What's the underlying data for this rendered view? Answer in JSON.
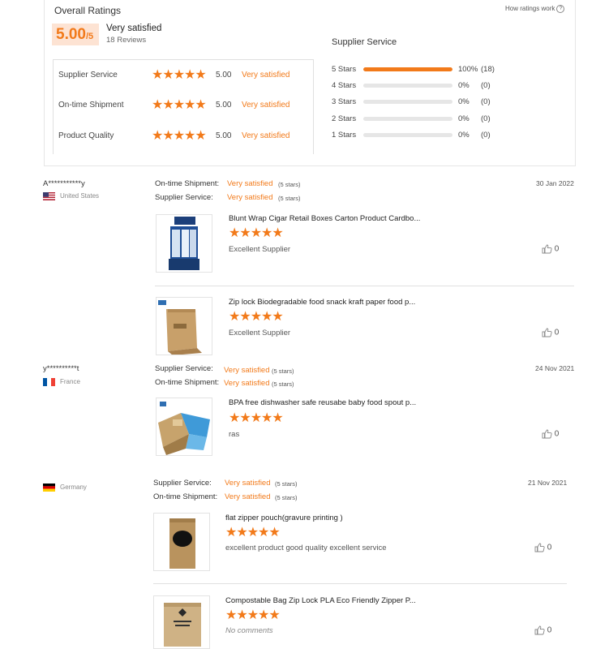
{
  "summary": {
    "title": "Overall Ratings",
    "how_link": "How ratings work",
    "score": "5.00",
    "score_max": "/5",
    "verdict": "Very satisfied",
    "reviews": "18 Reviews",
    "rows": [
      {
        "label": "Supplier Service",
        "stars": "★★★★★",
        "score": "5.00",
        "verdict": "Very satisfied"
      },
      {
        "label": "On-time Shipment",
        "stars": "★★★★★",
        "score": "5.00",
        "verdict": "Very satisfied"
      },
      {
        "label": "Product Quality",
        "stars": "★★★★★",
        "score": "5.00",
        "verdict": "Very satisfied"
      }
    ],
    "distribution": {
      "title": "Supplier Service",
      "items": [
        {
          "label": "5 Stars",
          "fraction": 1.0,
          "pct": "100%",
          "count": "(18)"
        },
        {
          "label": "4 Stars",
          "fraction": 0,
          "pct": "0%",
          "count": "(0)"
        },
        {
          "label": "3 Stars",
          "fraction": 0,
          "pct": "0%",
          "count": "(0)"
        },
        {
          "label": "2 Stars",
          "fraction": 0,
          "pct": "0%",
          "count": "(0)"
        },
        {
          "label": "1 Stars",
          "fraction": 0,
          "pct": "0%",
          "count": "(0)"
        }
      ]
    }
  },
  "reviews": [
    {
      "name": "A***********y",
      "country": "United States",
      "date": "30 Jan 2022",
      "meta": [
        {
          "label": "On-time Shipment:",
          "value": "Very satisfied",
          "stars": "(5 stars)"
        },
        {
          "label": "Supplier Service:",
          "value": "Very satisfied",
          "stars": "(5 stars)"
        }
      ],
      "products": [
        {
          "title": "Blunt Wrap Cigar Retail Boxes Carton Product Cardbo...",
          "stars": "★★★★★",
          "comment": "Excellent Supplier",
          "likes": "0"
        },
        {
          "title": "Zip lock Biodegradable food snack kraft paper food p...",
          "stars": "★★★★★",
          "comment": "Excellent Supplier",
          "likes": "0"
        }
      ]
    },
    {
      "name": "y**********t",
      "country": "France",
      "date": "24 Nov 2021",
      "meta": [
        {
          "label": "Supplier Service:",
          "value": "Very satisfied",
          "stars": "(5 stars)"
        },
        {
          "label": "On-time Shipment:",
          "value": "Very satisfied",
          "stars": "(5 stars)"
        }
      ],
      "products": [
        {
          "title": "BPA free dishwasher safe reusabe baby food spout p...",
          "stars": "★★★★★",
          "comment": "ras",
          "likes": "0"
        }
      ]
    },
    {
      "name": "",
      "country": "Germany",
      "date": "21 Nov 2021",
      "meta": [
        {
          "label": "Supplier Service:",
          "value": "Very satisfied",
          "stars": "(5 stars)"
        },
        {
          "label": "On-time Shipment:",
          "value": "Very satisfied",
          "stars": "(5 stars)"
        }
      ],
      "products": [
        {
          "title": "flat zipper pouch(gravure printing )",
          "stars": "★★★★★",
          "comment": "excellent product good quality excellent service",
          "likes": "0"
        },
        {
          "title": "Compostable Bag Zip Lock PLA Eco Friendly Zipper P...",
          "stars": "★★★★★",
          "comment": "No comments",
          "likes": "0"
        }
      ]
    }
  ],
  "colors": {
    "accent": "#f27a1a",
    "badge_bg": "#fde3d3"
  }
}
